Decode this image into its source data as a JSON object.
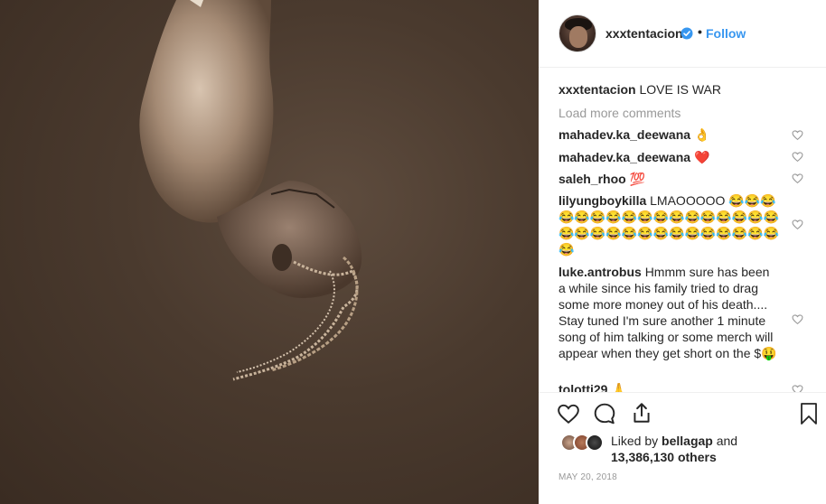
{
  "post": {
    "author": "xxxtentacion",
    "verified": true,
    "separator": "•",
    "follow_label": "Follow",
    "caption_user": "xxxtentacion",
    "caption_text": "LOVE IS WAR",
    "load_more": "Load more comments",
    "comments": [
      {
        "user": "mahadev.ka_deewana",
        "text": "👌"
      },
      {
        "user": "mahadev.ka_deewana",
        "text": "❤️"
      },
      {
        "user": "saleh_rhoo",
        "text": "💯"
      },
      {
        "user": "lilyungboykilla",
        "text": "LMAOOOOO 😂😂😂😂😂😂😂😂😂😂😂😂😂😂😂😂😂😂😂😂😂😂😂😂😂😂😂😂😂😂😂😂"
      },
      {
        "user": "luke.antrobus",
        "text": "Hmmm sure has been a while since his family tried to drag some more money out of his death.... Stay tuned I'm sure another 1 minute song of him talking or some merch will appear when they get short on the $🤑"
      },
      {
        "user": "tolotti29",
        "text": "🙏"
      }
    ],
    "liked_by_prefix": "Liked by",
    "liked_by_user": "bellagap",
    "liked_by_and": "and",
    "liked_by_count": "13,386,130 others",
    "date": "MAY 20, 2018"
  },
  "icons": {
    "like": "heart-icon",
    "comment": "comment-icon",
    "share": "share-icon",
    "save": "bookmark-icon",
    "verified": "verified-badge-icon"
  },
  "colors": {
    "link": "#3897f0",
    "muted": "#999999",
    "text": "#262626"
  }
}
